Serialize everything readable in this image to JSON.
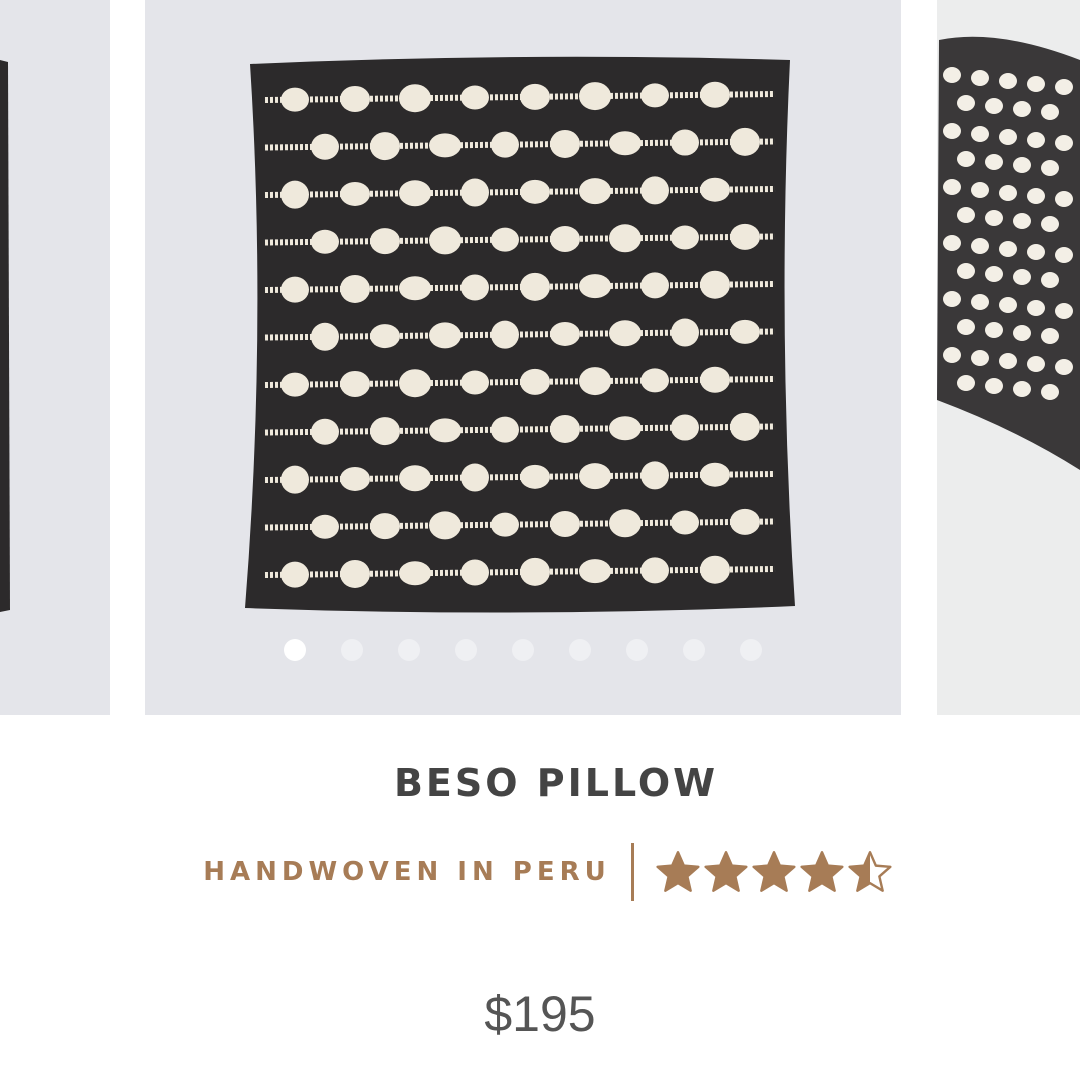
{
  "product": {
    "name": "BESO PILLOW",
    "origin": "HANDWOVEN IN PERU",
    "rating": 4.5,
    "rating_max": 5,
    "price": "$195"
  },
  "carousel": {
    "slide_count": 9,
    "active_index": 0,
    "colors": {
      "background": "#e4e5ea",
      "pillow": "#2c2a2b",
      "knot": "#efe9dc"
    }
  },
  "colors": {
    "accent": "#a77c56",
    "title": "#444444",
    "price": "#555555"
  }
}
